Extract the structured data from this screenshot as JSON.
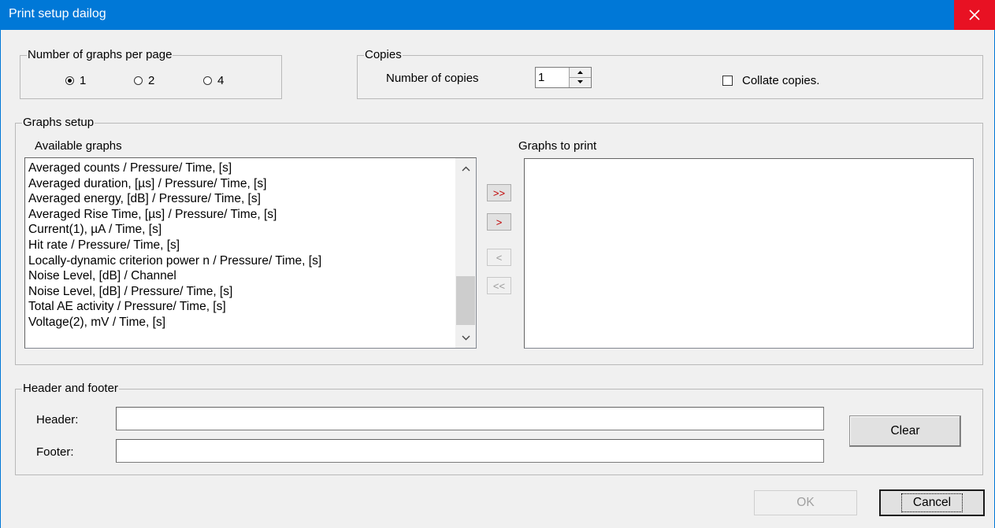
{
  "window": {
    "title": "Print setup dailog",
    "close_icon": "close-icon"
  },
  "graphs_per_page": {
    "legend": "Number of graphs per page",
    "options": [
      "1",
      "2",
      "4"
    ],
    "selected": "1"
  },
  "copies": {
    "legend": "Copies",
    "number_label": "Number of copies",
    "number_value": "1",
    "collate_label": "Collate copies.",
    "collate_checked": false
  },
  "graphs_setup": {
    "legend": "Graphs setup",
    "available_label": "Available graphs",
    "to_print_label": "Graphs to print",
    "available": [
      "Averaged counts / Pressure/ Time, [s]",
      "Averaged duration, [µs] / Pressure/ Time, [s]",
      "Averaged energy, [dB] / Pressure/ Time, [s]",
      "Averaged Rise Time, [µs] / Pressure/ Time, [s]",
      "Current(1), µA / Time, [s]",
      "Hit rate / Pressure/ Time, [s]",
      "Locally-dynamic criterion power n / Pressure/ Time, [s]",
      "Noise Level, [dB] / Channel",
      "Noise Level, [dB] / Pressure/ Time, [s]",
      "Total AE activity / Pressure/ Time, [s]",
      "Voltage(2), mV / Time, [s]"
    ],
    "to_print": [],
    "buttons": {
      "add_all": ">>",
      "add": ">",
      "remove": "<",
      "remove_all": "<<"
    }
  },
  "header_footer": {
    "legend": "Header and footer",
    "header_label": "Header:",
    "header_value": "",
    "footer_label": "Footer:",
    "footer_value": "",
    "clear_label": "Clear"
  },
  "actions": {
    "ok_label": "OK",
    "cancel_label": "Cancel"
  },
  "colors": {
    "titlebar": "#0078d7",
    "close_button": "#e81123",
    "active_arrow": "#c00000"
  }
}
